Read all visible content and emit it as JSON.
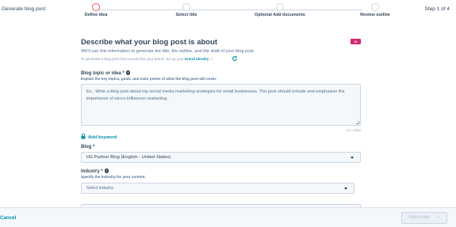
{
  "header": {
    "app_title": "Generate blog post",
    "step_count": "Step 1 of 4",
    "steps": [
      {
        "label": "Define idea",
        "active": true
      },
      {
        "label": "Select title",
        "active": false
      },
      {
        "label": "Optional Add documents",
        "active": false
      },
      {
        "label": "Review outline",
        "active": false
      }
    ]
  },
  "panel": {
    "title": "Describe what your blog post is about",
    "ai_badge": "AI",
    "description": "We'll use this information to generate the title, the outline, and the draft of your blog post.",
    "hint_prefix": "To generate a blog post that sounds like your brand, set up your ",
    "hint_link": "brand identity",
    "topic": {
      "label": "Blog topic or idea *",
      "help": "Explain the key topics, goals, and main points of what the blog post will cover.",
      "placeholder": "Ex., Write a blog post about top social media marketing strategies for small businesses. The post should include and emphasize the importance of micro-influencer marketing.",
      "counter": "173 / 3000"
    },
    "add_keyword": "Add keyword",
    "blog": {
      "label": "Blog *",
      "value": "HS Partner Blog (English - United States)"
    },
    "industry": {
      "label": "Industry *",
      "help": "Specify the industry for your content.",
      "value": "Select industry"
    }
  },
  "footer": {
    "cancel": "Cancel",
    "next": "Select title"
  },
  "colors": {
    "accent": "#0091ae",
    "active_step": "#f2545b",
    "ai_badge": "#d6276f"
  },
  "icons": [
    "info-icon",
    "lock-icon",
    "refresh-icon",
    "external-link-icon",
    "chevron-down-icon",
    "chevron-right-icon"
  ]
}
